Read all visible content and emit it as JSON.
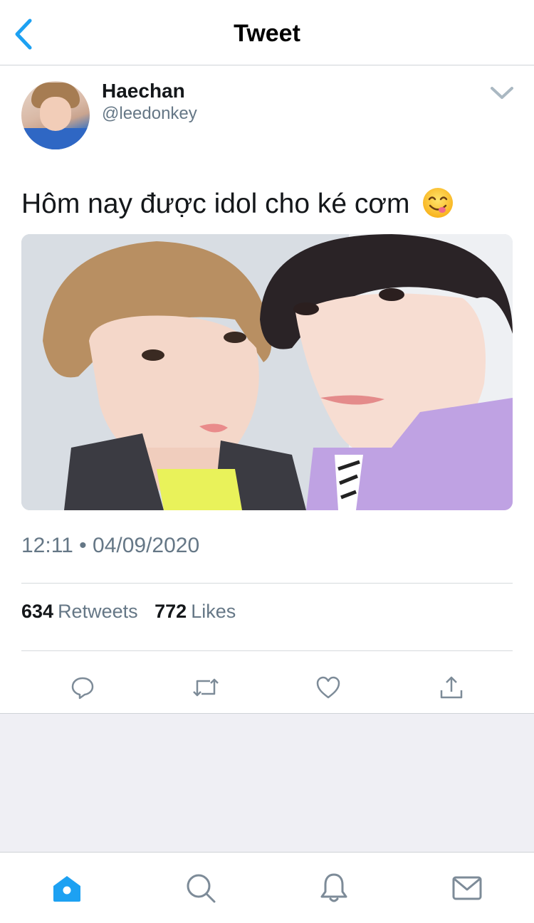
{
  "header": {
    "title": "Tweet",
    "back_icon": "chevron-left-icon"
  },
  "tweet": {
    "author": {
      "name": "Haechan",
      "handle": "@leedonkey"
    },
    "text": "Hôm nay được idol cho ké cơm",
    "emoji": "face-savoring-food-emoji",
    "photo": "selfie-photo",
    "timestamp": "12:11 • 04/09/2020",
    "stats": {
      "retweets_count": "634",
      "retweets_label": "Retweets",
      "likes_count": "772",
      "likes_label": "Likes"
    },
    "actions": [
      "reply-icon",
      "retweet-icon",
      "like-icon",
      "share-icon"
    ]
  },
  "tabbar": {
    "items": [
      "home-icon",
      "search-icon",
      "notifications-icon",
      "messages-icon"
    ],
    "active": "home-icon"
  },
  "colors": {
    "accent": "#1da1f2",
    "secondary_text": "#657786",
    "icon_gray": "#7d8b98",
    "background_gray": "#efeff4"
  }
}
